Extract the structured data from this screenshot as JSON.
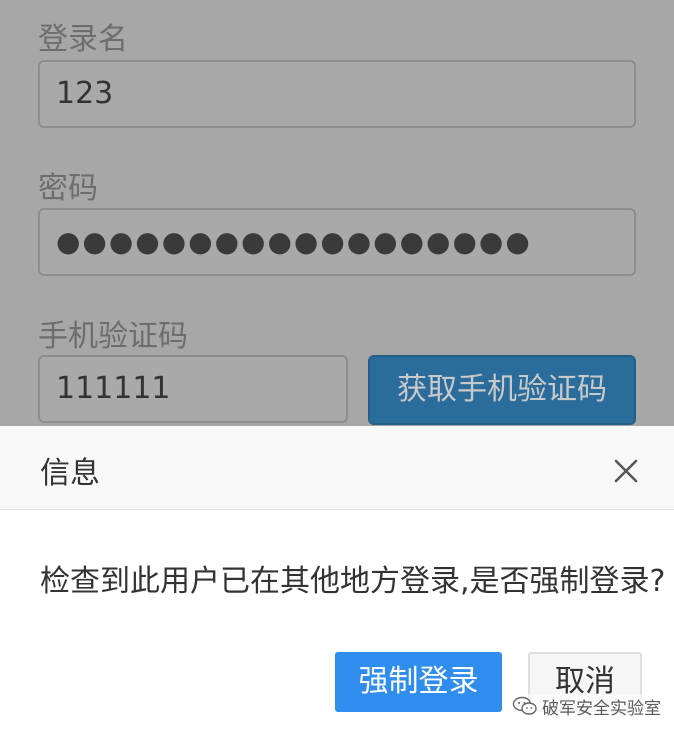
{
  "form": {
    "login_label": "登录名",
    "login_value": "123",
    "password_label": "密码",
    "password_value": "●●●●●●●●●●●●●●●●●●",
    "sms_label": "手机验证码",
    "sms_value": "111111",
    "sms_button": "获取手机验证码"
  },
  "dialog": {
    "title": "信息",
    "message": "检查到此用户已在其他地方登录,是否强制登录?",
    "confirm_label": "强制登录",
    "cancel_label": "取消",
    "close_icon": "close-icon"
  },
  "watermark": {
    "text": "破军安全实验室",
    "icon": "wechat-icon"
  },
  "colors": {
    "primary_button": "#2e8ded",
    "sms_button": "#2a6c9b",
    "overlay_background": "#a7a7a7"
  }
}
